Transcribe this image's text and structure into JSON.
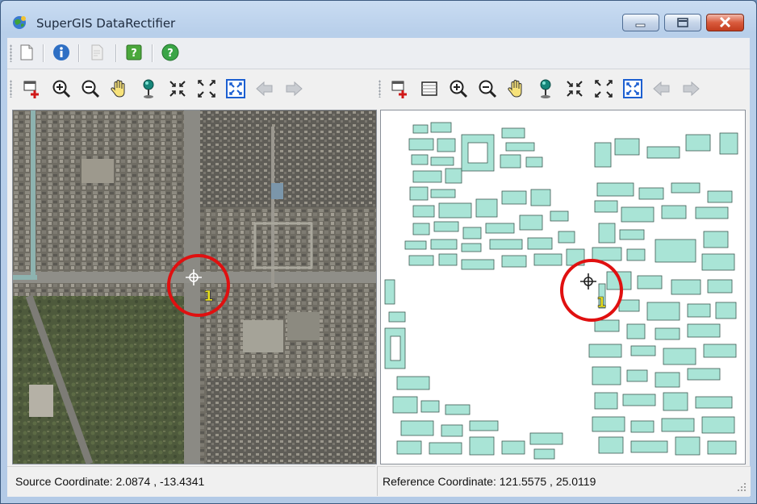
{
  "window": {
    "title": "SuperGIS DataRectifier",
    "controls": {
      "minimize": "minimize",
      "maximize": "maximize",
      "close": "close"
    }
  },
  "toolbar_main": {
    "icons": [
      "new-document-icon",
      "info-icon",
      "document-disabled-icon",
      "help-green-icon",
      "help-circle-icon"
    ]
  },
  "source_toolbar": {
    "icons": [
      "add-control-point-icon",
      "zoom-in-icon",
      "zoom-out-icon",
      "pan-hand-icon",
      "identify-pin-icon",
      "zoom-in-fixed-icon",
      "zoom-out-fixed-icon",
      "full-extent-icon",
      "back-arrow-icon",
      "forward-arrow-icon"
    ]
  },
  "reference_toolbar": {
    "icons": [
      "add-control-point-icon",
      "layer-icon",
      "zoom-in-icon",
      "zoom-out-icon",
      "pan-hand-icon",
      "identify-pin-icon",
      "zoom-in-fixed-icon",
      "zoom-out-fixed-icon",
      "full-extent-icon",
      "back-arrow-icon",
      "forward-arrow-icon"
    ]
  },
  "source_map": {
    "control_point_label": "1",
    "marker_color": "#e01010"
  },
  "reference_map": {
    "control_point_label": "1",
    "marker_color": "#e01010",
    "feature_color": "#a9e4d6"
  },
  "status": {
    "source": "Source Coordinate:  2.0874 , -13.4341",
    "reference": "Reference Coordinate:  121.5575 , 25.0119"
  }
}
